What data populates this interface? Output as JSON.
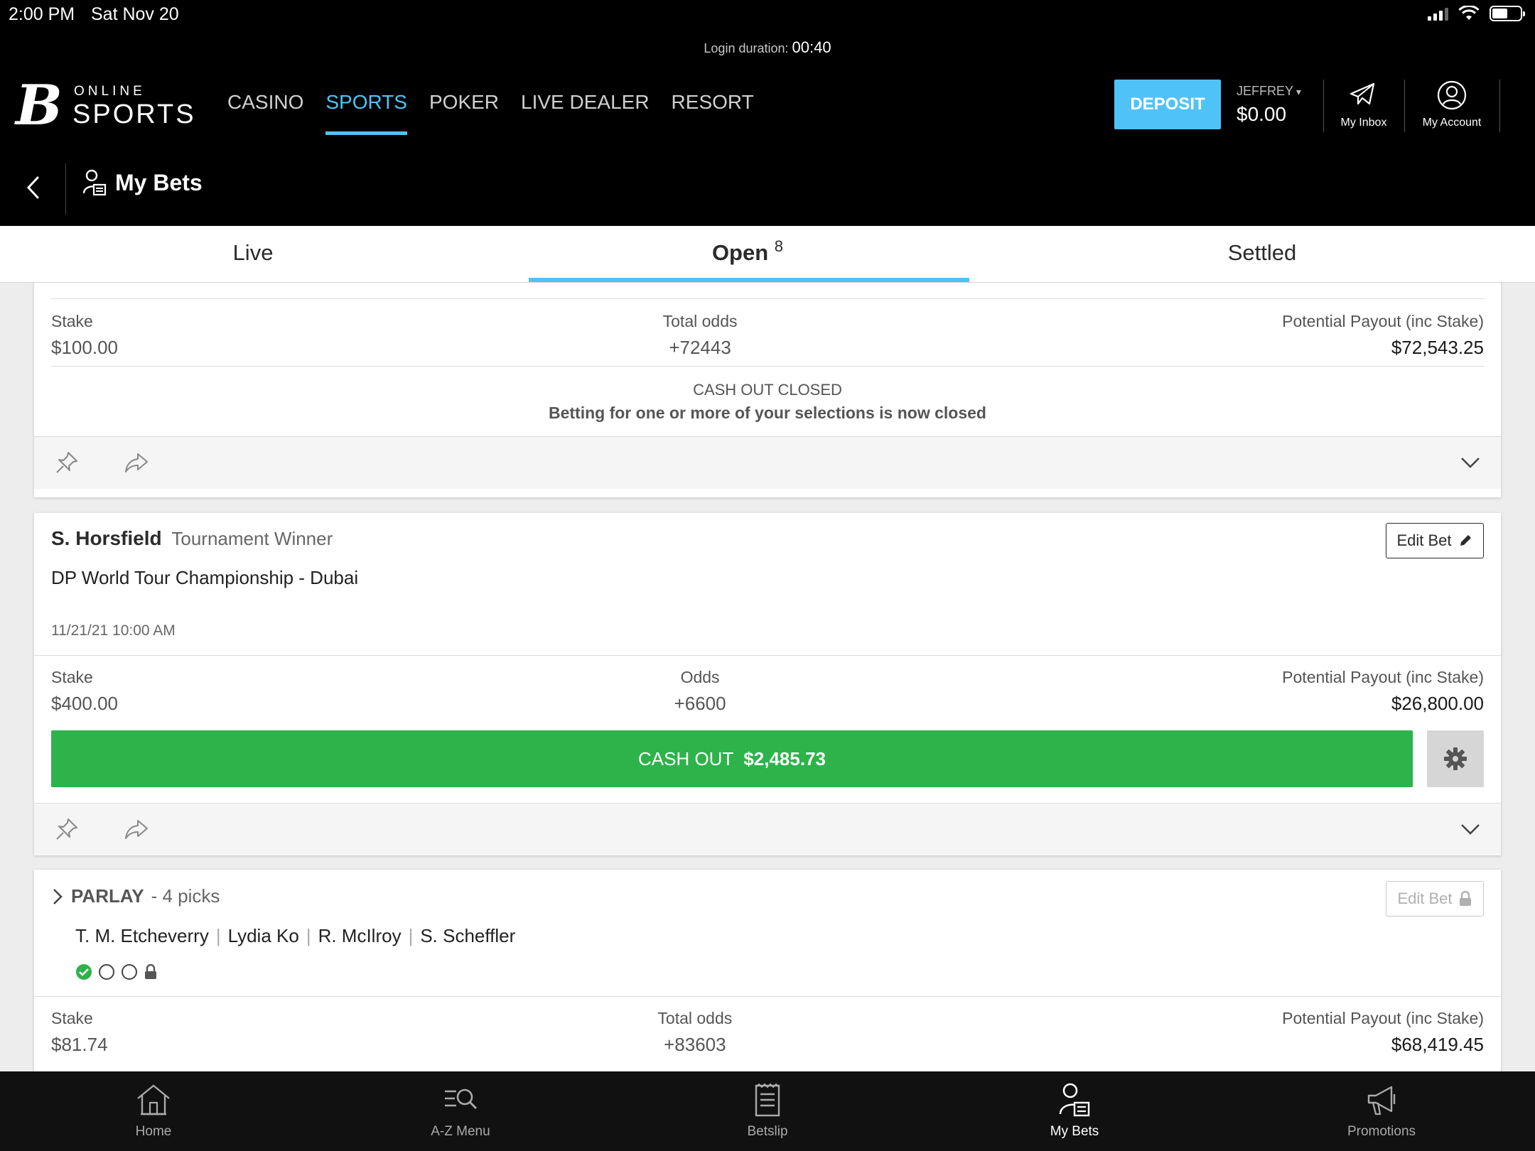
{
  "status_bar": {
    "time": "2:00 PM",
    "date": "Sat Nov 20"
  },
  "header": {
    "login_label": "Login duration:",
    "login_time": "00:40",
    "logo": {
      "mark": "B",
      "online": "ONLINE",
      "sports": "SPORTS"
    },
    "nav": [
      "CASINO",
      "SPORTS",
      "POKER",
      "LIVE DEALER",
      "RESORT"
    ],
    "nav_active": "SPORTS",
    "deposit_label": "DEPOSIT",
    "username": "JEFFREY",
    "balance": "$0.00",
    "inbox_label": "My Inbox",
    "account_label": "My Account"
  },
  "subheader": {
    "title": "My Bets"
  },
  "tabs": {
    "live": "Live",
    "open": "Open",
    "open_count": "8",
    "settled": "Settled"
  },
  "bets": {
    "first": {
      "stake_label": "Stake",
      "stake": "$100.00",
      "odds_label": "Total odds",
      "odds": "+72443",
      "payout_label": "Potential Payout (inc Stake)",
      "payout": "$72,543.25",
      "cashout_closed_title": "CASH OUT CLOSED",
      "cashout_closed_msg": "Betting for one or more of your selections is now closed"
    },
    "second": {
      "selection": "S. Horsfield",
      "market": "Tournament Winner",
      "event": "DP World Tour Championship - Dubai",
      "datetime": "11/21/21 10:00 AM",
      "edit_label": "Edit Bet",
      "stake_label": "Stake",
      "stake": "$400.00",
      "odds_label": "Odds",
      "odds": "+6600",
      "payout_label": "Potential Payout (inc Stake)",
      "payout": "$26,800.00",
      "cashout_label": "CASH OUT",
      "cashout_value": "$2,485.73"
    },
    "third": {
      "type": "PARLAY",
      "picks": "- 4 picks",
      "edit_label": "Edit Bet",
      "legs": [
        "T. M. Etcheverry",
        "Lydia Ko",
        "R. McIlroy",
        "S. Scheffler"
      ],
      "stake_label": "Stake",
      "stake": "$81.74",
      "odds_label": "Total odds",
      "odds": "+83603",
      "payout_label": "Potential Payout (inc Stake)",
      "payout": "$68,419.45"
    }
  },
  "bottom_nav": [
    {
      "label": "Home",
      "icon": "home-icon"
    },
    {
      "label": "A-Z Menu",
      "icon": "az-menu-icon"
    },
    {
      "label": "Betslip",
      "icon": "betslip-icon"
    },
    {
      "label": "My Bets",
      "icon": "mybets-icon"
    },
    {
      "label": "Promotions",
      "icon": "megaphone-icon"
    }
  ],
  "colors": {
    "accent": "#4fc3f7",
    "cashout": "#2db34a",
    "header_bg": "#000000"
  }
}
